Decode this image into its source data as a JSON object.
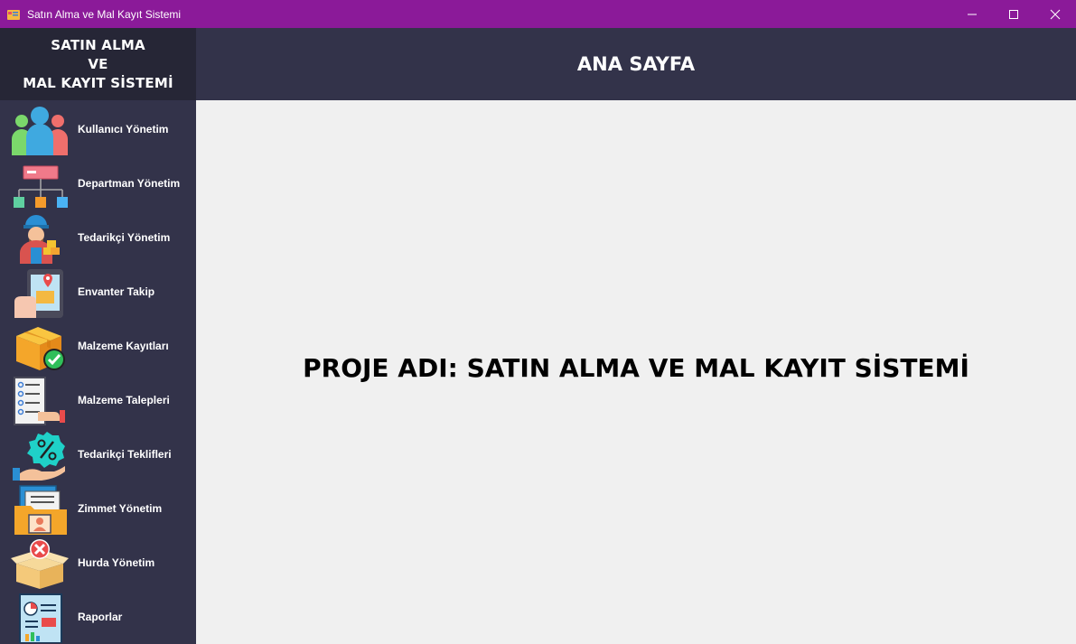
{
  "window": {
    "title": "Satın Alma ve Mal Kayıt Sistemi",
    "accent": "#8b1a99"
  },
  "sidebar": {
    "brand_lines": [
      "SATIN ALMA",
      "VE",
      "MAL KAYIT SİSTEMİ"
    ],
    "background": "#33334a",
    "items": [
      {
        "label": "Kullanıcı Yönetim",
        "icon": "users-icon"
      },
      {
        "label": "Departman Yönetim",
        "icon": "org-chart-icon"
      },
      {
        "label": "Tedarikçi Yönetim",
        "icon": "supplier-icon"
      },
      {
        "label": "Envanter Takip",
        "icon": "inventory-tracking-icon"
      },
      {
        "label": "Malzeme Kayıtları",
        "icon": "box-check-icon"
      },
      {
        "label": "Malzeme Talepleri",
        "icon": "checklist-request-icon"
      },
      {
        "label": "Tedarikçi Teklifleri",
        "icon": "discount-offer-icon"
      },
      {
        "label": "Zimmet Yönetim",
        "icon": "folder-assignment-icon"
      },
      {
        "label": "Hurda Yönetim",
        "icon": "scrap-box-icon"
      },
      {
        "label": "Raporlar",
        "icon": "report-icon"
      }
    ]
  },
  "header": {
    "title": "ANA SAYFA"
  },
  "main": {
    "project_title": "PROJE ADI: SATIN ALMA VE MAL KAYIT SİSTEMİ"
  }
}
